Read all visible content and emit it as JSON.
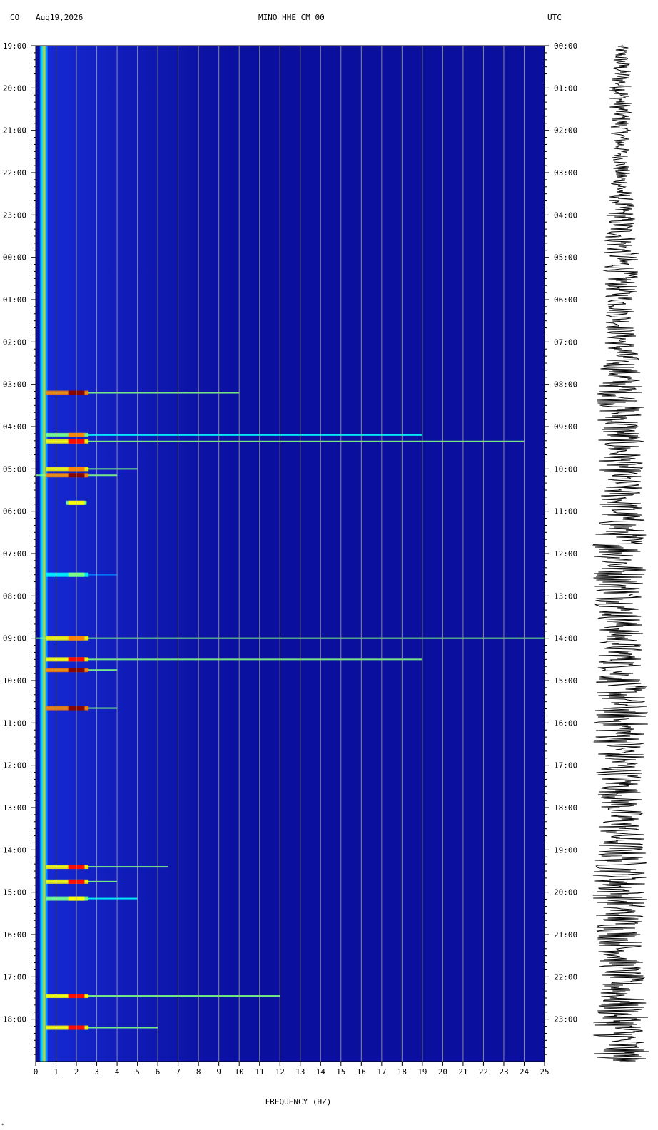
{
  "header": {
    "network": "CO",
    "date": "Aug19,2026",
    "channel": "MINO HHE CM 00",
    "timezone": "UTC"
  },
  "footer_mark": "*",
  "chart_data": {
    "type": "heatmap",
    "title": "MINO HHE CM 00",
    "xlabel": "FREQUENCY (HZ)",
    "x_ticks": [
      0,
      1,
      2,
      3,
      4,
      5,
      6,
      7,
      8,
      9,
      10,
      11,
      12,
      13,
      14,
      15,
      16,
      17,
      18,
      19,
      20,
      21,
      22,
      23,
      24,
      25
    ],
    "xlim": [
      0,
      25
    ],
    "y_left_labels": [
      "19:00",
      "20:00",
      "21:00",
      "22:00",
      "23:00",
      "00:00",
      "01:00",
      "02:00",
      "03:00",
      "04:00",
      "05:00",
      "06:00",
      "07:00",
      "08:00",
      "09:00",
      "10:00",
      "11:00",
      "12:00",
      "13:00",
      "14:00",
      "15:00",
      "16:00",
      "17:00",
      "18:00"
    ],
    "y_right_labels": [
      "00:00",
      "01:00",
      "02:00",
      "03:00",
      "04:00",
      "05:00",
      "06:00",
      "07:00",
      "08:00",
      "09:00",
      "10:00",
      "11:00",
      "12:00",
      "13:00",
      "14:00",
      "15:00",
      "16:00",
      "17:00",
      "18:00",
      "19:00",
      "20:00",
      "21:00",
      "22:00",
      "23:00"
    ],
    "y_range_hours": [
      0,
      24
    ],
    "grid": true,
    "colormap": [
      "#000080",
      "#0000ff",
      "#0080ff",
      "#00ffff",
      "#80ff80",
      "#ffff00",
      "#ff8000",
      "#ff0000",
      "#800000"
    ],
    "background_color": "#0a0f9e",
    "grid_color": "#b4b48c",
    "low_freq_band": {
      "freq_range": [
        0.2,
        0.6
      ],
      "color": "#00d8ff",
      "edge_color": "#ffcc00"
    },
    "features": [
      {
        "time_hours": 8.2,
        "freq_range": [
          0.5,
          10
        ],
        "intensity": 0.95
      },
      {
        "time_hours": 9.2,
        "freq_range": [
          0.5,
          19
        ],
        "intensity": 0.7
      },
      {
        "time_hours": 9.35,
        "freq_range": [
          0.5,
          24
        ],
        "intensity": 0.85
      },
      {
        "time_hours": 10.0,
        "freq_range": [
          0.5,
          5
        ],
        "intensity": 0.8
      },
      {
        "time_hours": 10.15,
        "freq_range": [
          0,
          4
        ],
        "intensity": 0.95
      },
      {
        "time_hours": 10.8,
        "freq_range": [
          1.5,
          2.5
        ],
        "intensity": 0.6
      },
      {
        "time_hours": 12.5,
        "freq_range": [
          0.5,
          4
        ],
        "intensity": 0.5
      },
      {
        "time_hours": 14.0,
        "freq_range": [
          0,
          25
        ],
        "intensity": 0.8
      },
      {
        "time_hours": 14.5,
        "freq_range": [
          0.5,
          19
        ],
        "intensity": 0.85
      },
      {
        "time_hours": 14.75,
        "freq_range": [
          0.5,
          4
        ],
        "intensity": 0.95
      },
      {
        "time_hours": 15.65,
        "freq_range": [
          0.5,
          4
        ],
        "intensity": 1.0
      },
      {
        "time_hours": 19.4,
        "freq_range": [
          0.5,
          6.5
        ],
        "intensity": 0.9
      },
      {
        "time_hours": 19.75,
        "freq_range": [
          0.5,
          4
        ],
        "intensity": 0.85
      },
      {
        "time_hours": 20.15,
        "freq_range": [
          0.5,
          5
        ],
        "intensity": 0.6
      },
      {
        "time_hours": 22.45,
        "freq_range": [
          0.5,
          12
        ],
        "intensity": 0.9
      },
      {
        "time_hours": 23.2,
        "freq_range": [
          0.5,
          6
        ],
        "intensity": 0.85
      }
    ],
    "seismogram_color": "#000000"
  }
}
